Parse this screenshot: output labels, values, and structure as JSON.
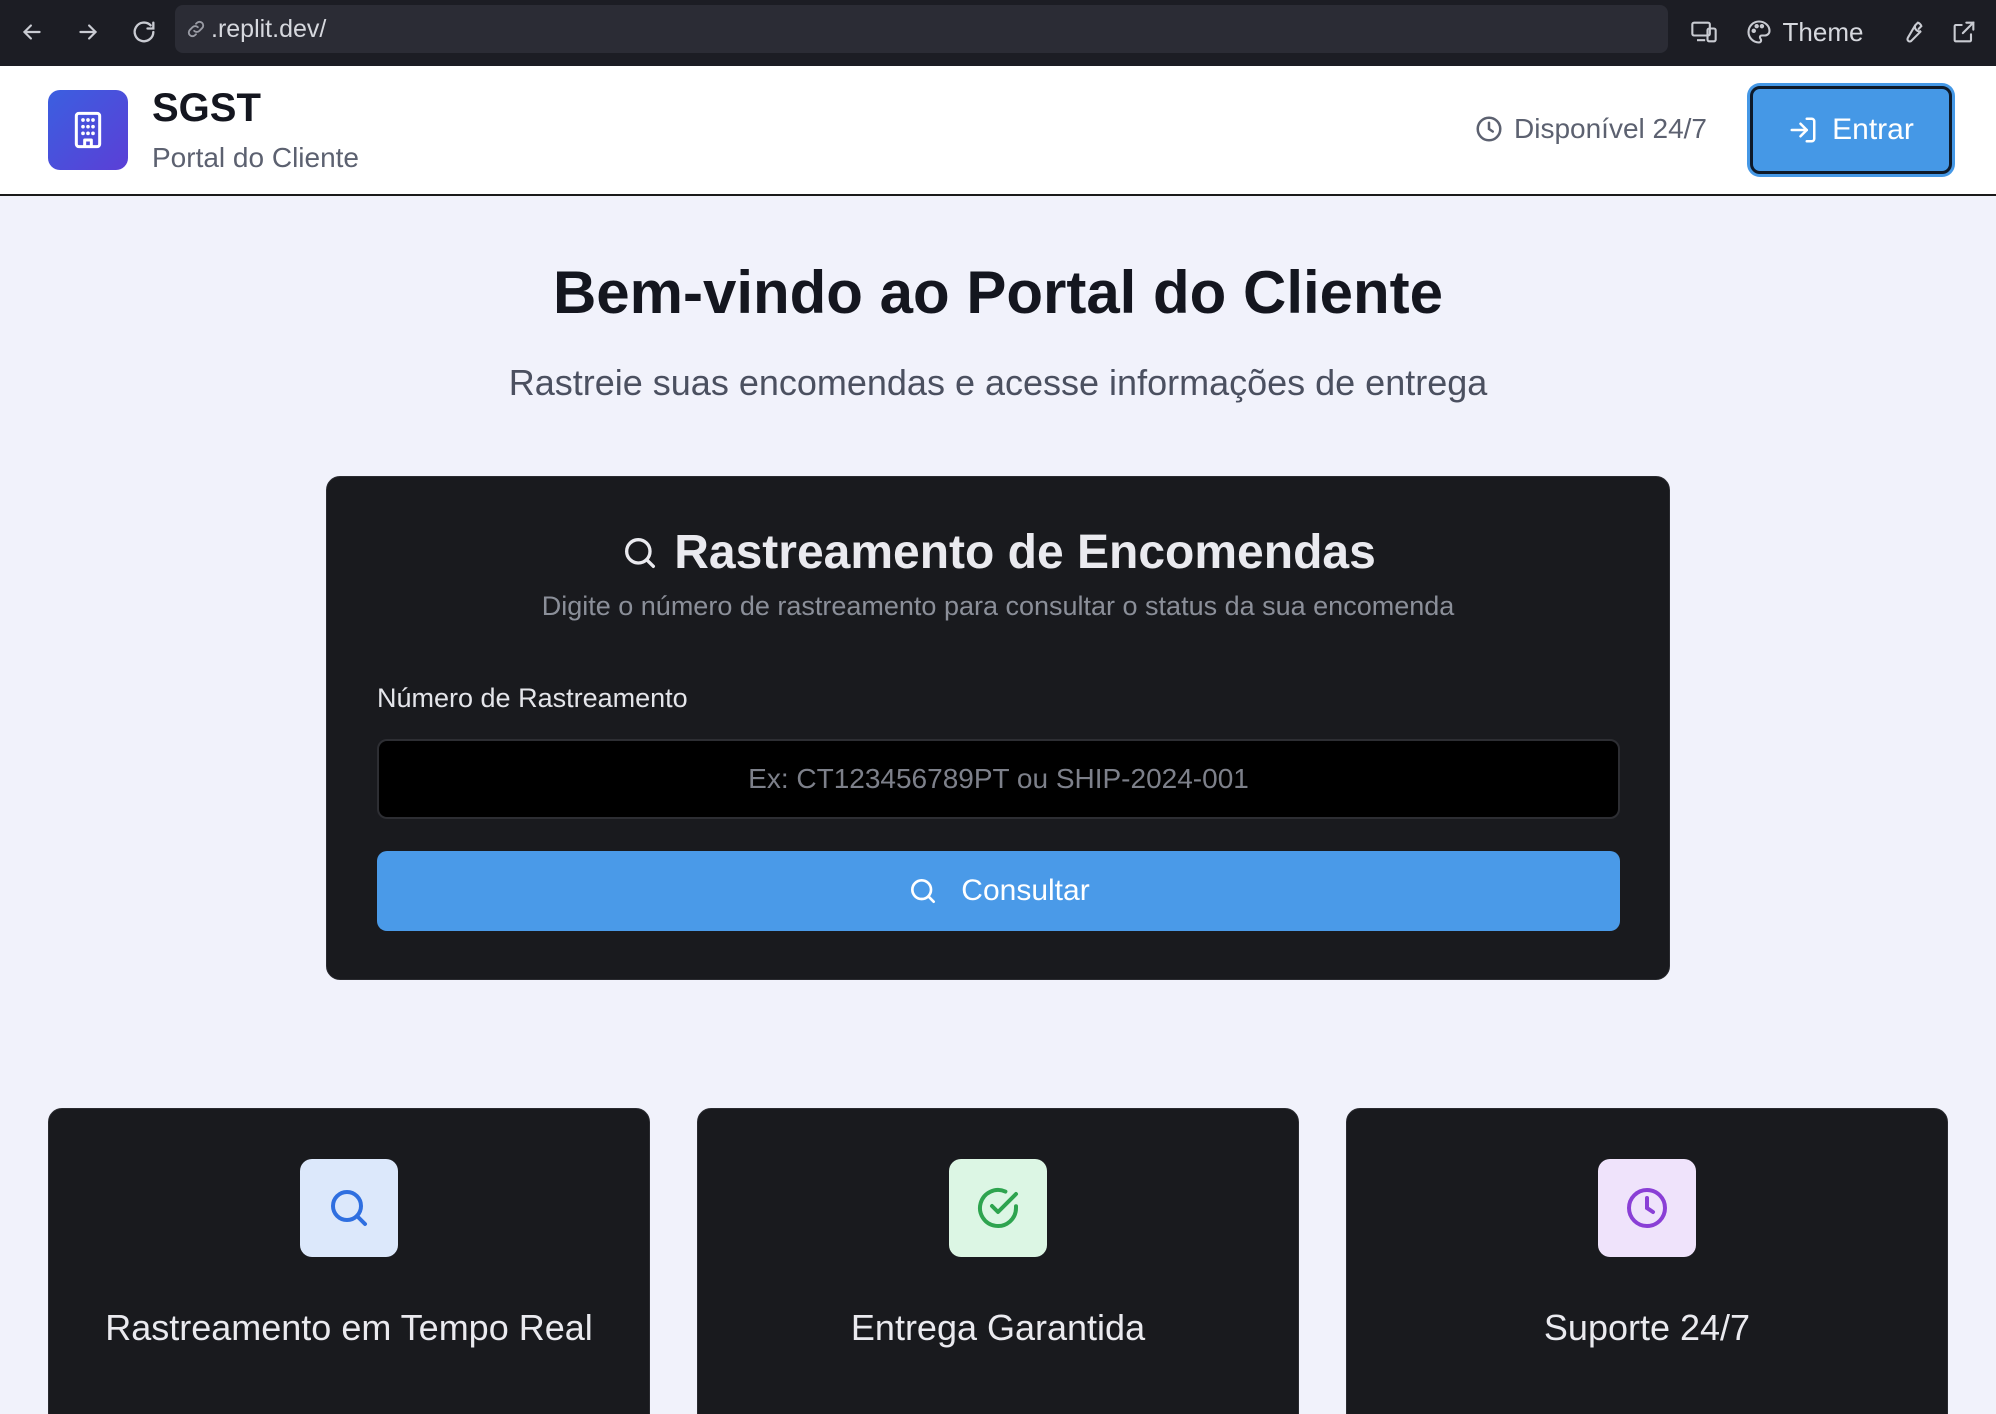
{
  "browser": {
    "url": ".replit.dev/",
    "theme_label": "Theme"
  },
  "header": {
    "brand_title": "SGST",
    "brand_subtitle": "Portal do Cliente",
    "availability": "Disponível 24/7",
    "login_label": "Entrar"
  },
  "hero": {
    "title": "Bem-vindo ao Portal do Cliente",
    "subtitle": "Rastreie suas encomendas e acesse informações de entrega"
  },
  "tracking": {
    "title": "Rastreamento de Encomendas",
    "description": "Digite o número de rastreamento para consultar o status da sua encomenda",
    "field_label": "Número de Rastreamento",
    "input_value": "",
    "input_placeholder": "Ex: CT123456789PT ou SHIP-2024-001",
    "submit_label": "Consultar"
  },
  "features": [
    {
      "title": "Rastreamento em Tempo Real",
      "icon": "search-icon",
      "icon_bg": "#dce8fb",
      "icon_color": "#2f6fe0"
    },
    {
      "title": "Entrega Garantida",
      "icon": "check-circle-icon",
      "icon_bg": "#dcf6e4",
      "icon_color": "#2ea44f"
    },
    {
      "title": "Suporte 24/7",
      "icon": "clock-icon",
      "icon_bg": "#efe3fb",
      "icon_color": "#8a3fd6"
    }
  ],
  "colors": {
    "accent": "#4598e6",
    "brand_gradient_start": "#3b5fe0",
    "brand_gradient_end": "#5b3fd6",
    "card_bg": "#191a1e"
  }
}
